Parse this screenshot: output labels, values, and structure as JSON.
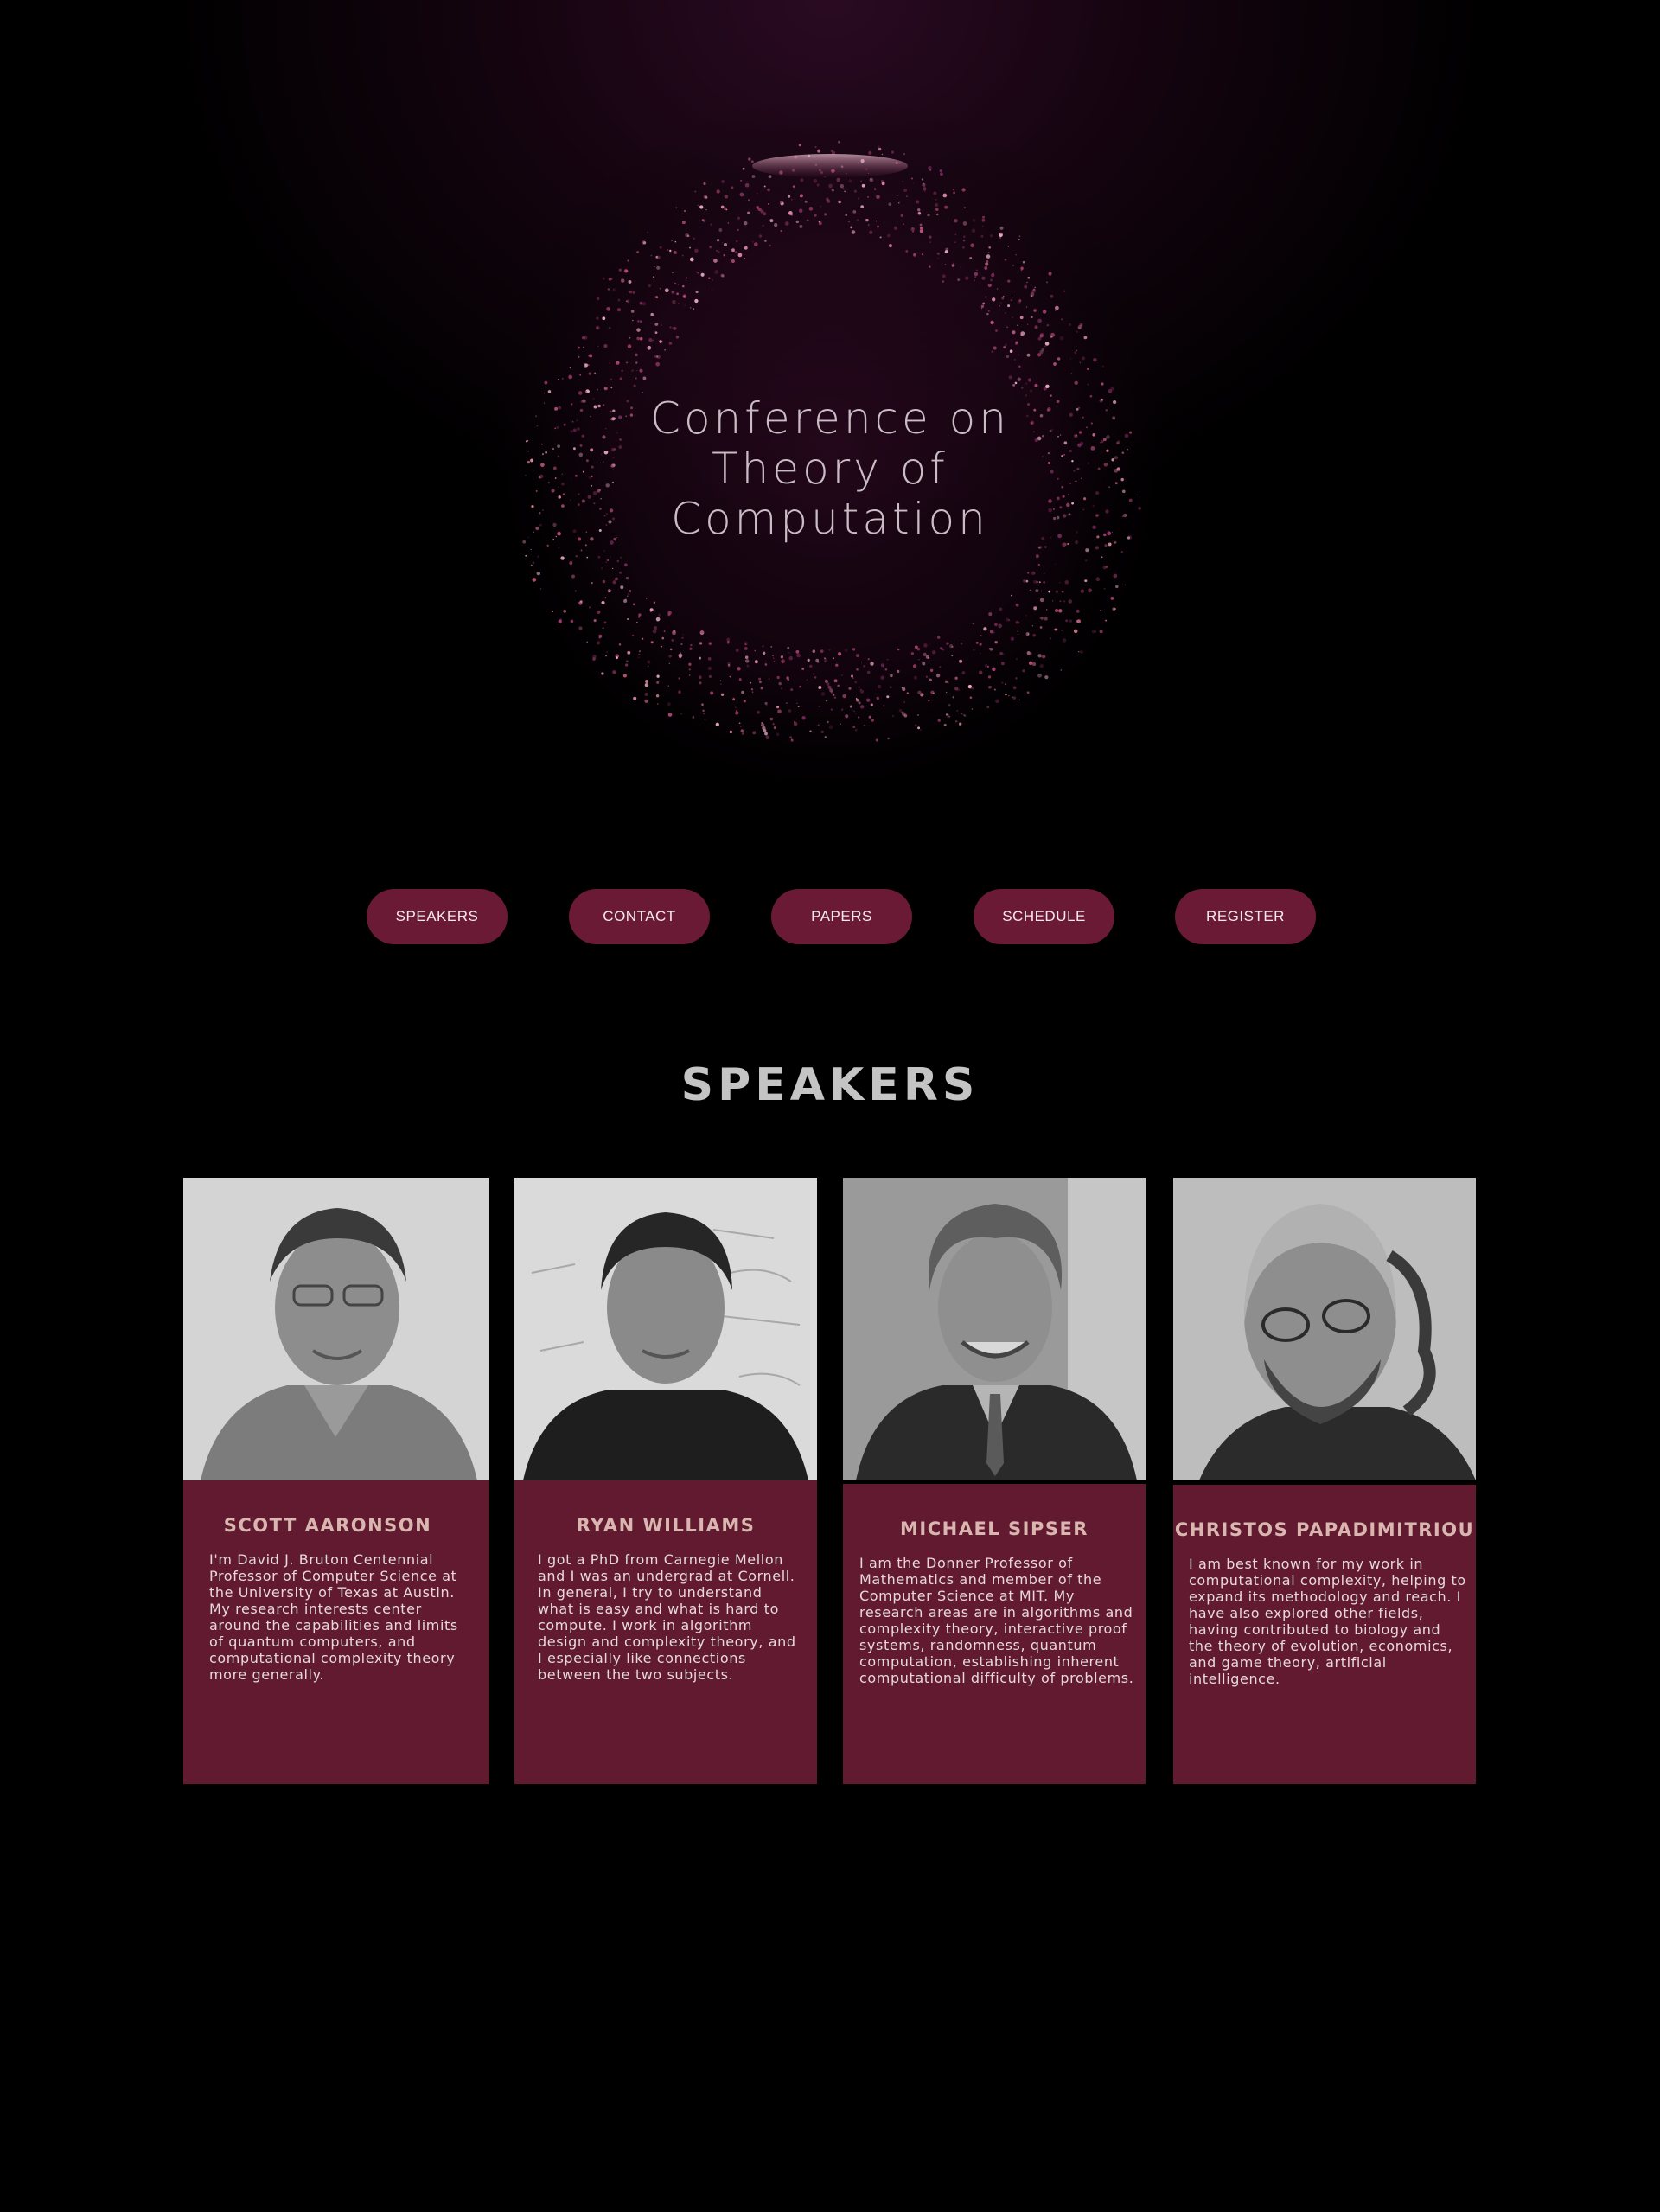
{
  "hero": {
    "title_lines": [
      "Conference on",
      "Theory of",
      "Computation"
    ]
  },
  "nav": {
    "items": [
      {
        "label": "SPEAKERS"
      },
      {
        "label": "CONTACT"
      },
      {
        "label": "PAPERS"
      },
      {
        "label": "SCHEDULE"
      },
      {
        "label": "REGISTER"
      }
    ]
  },
  "speakers": {
    "heading": "SPEAKERS",
    "cards": [
      {
        "name": "SCOTT AARONSON",
        "bio": "I'm David J. Bruton Centennial Professor of Computer Science at the University of Texas at Austin. My research interests center around the capabilities and limits of quantum computers, and computational complexity theory more generally."
      },
      {
        "name": "RYAN WILLIAMS",
        "bio": "I got a PhD from Carnegie Mellon and I was an undergrad at Cornell. In general, I try to understand what is easy and what is hard to compute. I work in algorithm design and complexity theory, and I especially like connections between the two subjects."
      },
      {
        "name": "MICHAEL SIPSER",
        "bio": "I am the Donner Professor of Mathematics and member of the Computer Science at MIT. My research areas are in algorithms and complexity theory, interactive proof systems, randomness, quantum computation, establishing inherent computational difficulty of problems."
      },
      {
        "name": "CHRISTOS PAPADIMITRIOU",
        "bio": "I am best known for my work in computational complexity, helping to expand its methodology and reach. I have also explored other fields, having contributed to biology and the theory of evolution, economics, and game theory, artificial intelligence."
      }
    ]
  },
  "colors": {
    "accent": "#6a1a35",
    "card_bg": "#621a31",
    "background": "#000000"
  }
}
